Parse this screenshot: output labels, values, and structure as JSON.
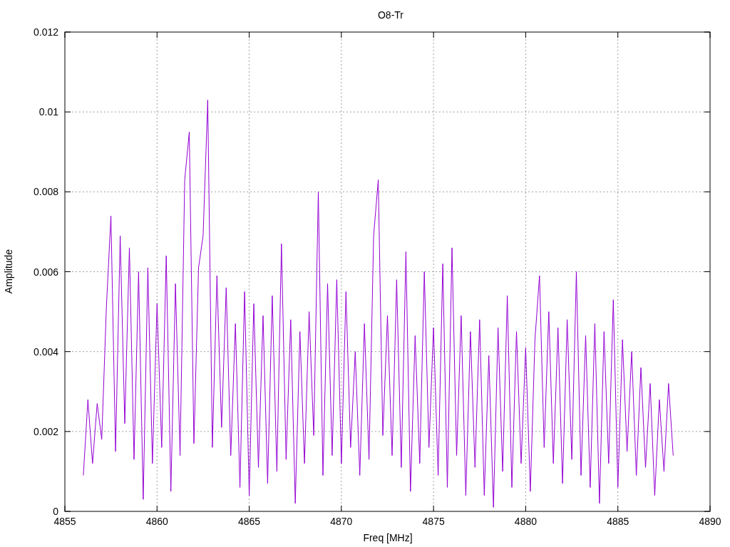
{
  "chart_data": {
    "type": "line",
    "title": "O8-Tr",
    "xlabel": "Freq [MHz]",
    "ylabel": "Amplitude",
    "xlim": [
      4855,
      4890
    ],
    "ylim": [
      0,
      0.012
    ],
    "grid": true,
    "xticks": [
      4855,
      4860,
      4865,
      4870,
      4875,
      4880,
      4885,
      4890
    ],
    "yticks": [
      0,
      0.002,
      0.004,
      0.006,
      0.008,
      0.01,
      0.012
    ],
    "x": [
      4856,
      4856.25,
      4856.5,
      4856.75,
      4857,
      4857.25,
      4857.5,
      4857.75,
      4858,
      4858.25,
      4858.5,
      4858.75,
      4859,
      4859.25,
      4859.5,
      4859.75,
      4860,
      4860.25,
      4860.5,
      4860.75,
      4861,
      4861.25,
      4861.5,
      4861.75,
      4862,
      4862.25,
      4862.5,
      4862.75,
      4863,
      4863.25,
      4863.5,
      4863.75,
      4864,
      4864.25,
      4864.5,
      4864.75,
      4865,
      4865.25,
      4865.5,
      4865.75,
      4866,
      4866.25,
      4866.5,
      4866.75,
      4867,
      4867.25,
      4867.5,
      4867.75,
      4868,
      4868.25,
      4868.5,
      4868.75,
      4869,
      4869.25,
      4869.5,
      4869.75,
      4870,
      4870.25,
      4870.5,
      4870.75,
      4871,
      4871.25,
      4871.5,
      4871.75,
      4872,
      4872.25,
      4872.5,
      4872.75,
      4873,
      4873.25,
      4873.5,
      4873.75,
      4874,
      4874.25,
      4874.5,
      4874.75,
      4875,
      4875.25,
      4875.5,
      4875.75,
      4876,
      4876.25,
      4876.5,
      4876.75,
      4877,
      4877.25,
      4877.5,
      4877.75,
      4878,
      4878.25,
      4878.5,
      4878.75,
      4879,
      4879.25,
      4879.5,
      4879.75,
      4880,
      4880.25,
      4880.5,
      4880.75,
      4881,
      4881.25,
      4881.5,
      4881.75,
      4882,
      4882.25,
      4882.5,
      4882.75,
      4883,
      4883.25,
      4883.5,
      4883.75,
      4884,
      4884.25,
      4884.5,
      4884.75,
      4885,
      4885.25,
      4885.5,
      4885.75,
      4886,
      4886.25,
      4886.5,
      4886.75,
      4887,
      4887.25,
      4887.5,
      4887.75,
      4888
    ],
    "series": [
      {
        "color": "#9400d3",
        "values": [
          0.0009,
          0.0028,
          0.0012,
          0.0027,
          0.0018,
          0.0051,
          0.0074,
          0.0015,
          0.0069,
          0.0022,
          0.0066,
          0.0013,
          0.006,
          0.0003,
          0.0061,
          0.0012,
          0.0052,
          0.0016,
          0.0064,
          0.0005,
          0.0057,
          0.0014,
          0.0083,
          0.0095,
          0.0017,
          0.0061,
          0.0069,
          0.0103,
          0.0016,
          0.0059,
          0.0021,
          0.0056,
          0.0014,
          0.0047,
          0.0006,
          0.0055,
          0.0004,
          0.0052,
          0.0011,
          0.0049,
          0.0007,
          0.0054,
          0.001,
          0.0067,
          0.0013,
          0.0048,
          0.0002,
          0.0045,
          0.0012,
          0.005,
          0.0019,
          0.008,
          0.0009,
          0.0057,
          0.0014,
          0.0058,
          0.0012,
          0.0055,
          0.0016,
          0.004,
          0.0009,
          0.0047,
          0.0013,
          0.0069,
          0.0083,
          0.0019,
          0.0049,
          0.0014,
          0.0058,
          0.0011,
          0.0065,
          0.0005,
          0.0044,
          0.0012,
          0.006,
          0.0016,
          0.0046,
          0.0009,
          0.0062,
          0.0006,
          0.0066,
          0.0014,
          0.0049,
          0.0004,
          0.0045,
          0.0011,
          0.0048,
          0.0004,
          0.0039,
          0.0001,
          0.0046,
          0.001,
          0.0054,
          0.0006,
          0.0045,
          0.0012,
          0.0041,
          0.0005,
          0.0043,
          0.0059,
          0.0016,
          0.005,
          0.0012,
          0.0046,
          0.0007,
          0.0048,
          0.0013,
          0.006,
          0.0009,
          0.0044,
          0.0006,
          0.0047,
          0.0002,
          0.0045,
          0.0012,
          0.0053,
          0.0006,
          0.0043,
          0.0015,
          0.004,
          0.0009,
          0.0036,
          0.0011,
          0.0032,
          0.0004,
          0.0028,
          0.001,
          0.0032,
          0.0014
        ]
      }
    ]
  }
}
